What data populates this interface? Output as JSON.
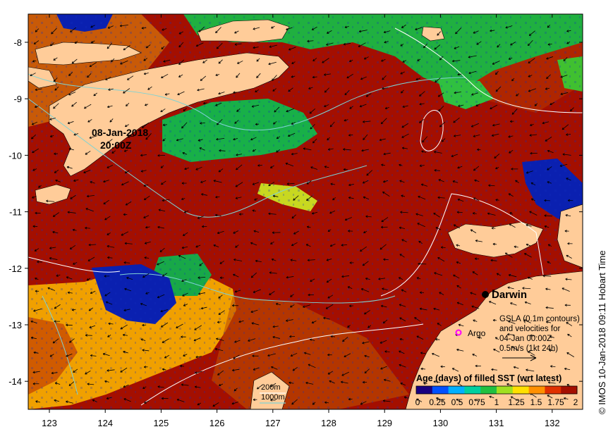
{
  "map": {
    "timestamp_date": "08-Jan-2018",
    "timestamp_time": "20:00Z",
    "place_label": "Darwin",
    "argo_label": "Argo",
    "gsla_lines": [
      "GSLA (0.1m contours)",
      "and velocities for",
      "04-Jan 00:00Z",
      "0.5m/s (1kt 24h)"
    ],
    "depth_contours": [
      {
        "label": "200m",
        "color": "#ffffff"
      },
      {
        "label": "1000m",
        "color": "#7fd3d3"
      }
    ],
    "credit": "© IMOS 10-Jan-2018 09:11 Hobart Time",
    "colors": {
      "ocean": "#a40f00",
      "land": "#ffcc99",
      "argo": "#ff00ff"
    }
  },
  "axes": {
    "lon_ticks": [
      "123",
      "124",
      "125",
      "126",
      "127",
      "128",
      "129",
      "130",
      "131",
      "132"
    ],
    "lat_ticks": [
      "-8",
      "-9",
      "-10",
      "-11",
      "-12",
      "-13",
      "-14"
    ]
  },
  "colorbar": {
    "title": "Age (days) of filled SST (wrt latest)",
    "ticks": [
      "0",
      "0.25",
      "0.5",
      "0.75",
      "1",
      "1.25",
      "1.5",
      "1.75",
      "2"
    ],
    "colors": [
      "#1a0080",
      "#0050ff",
      "#00b0ff",
      "#00d0a0",
      "#20c040",
      "#a0e020",
      "#ffe000",
      "#ff9000",
      "#e03000",
      "#a40f00"
    ]
  }
}
